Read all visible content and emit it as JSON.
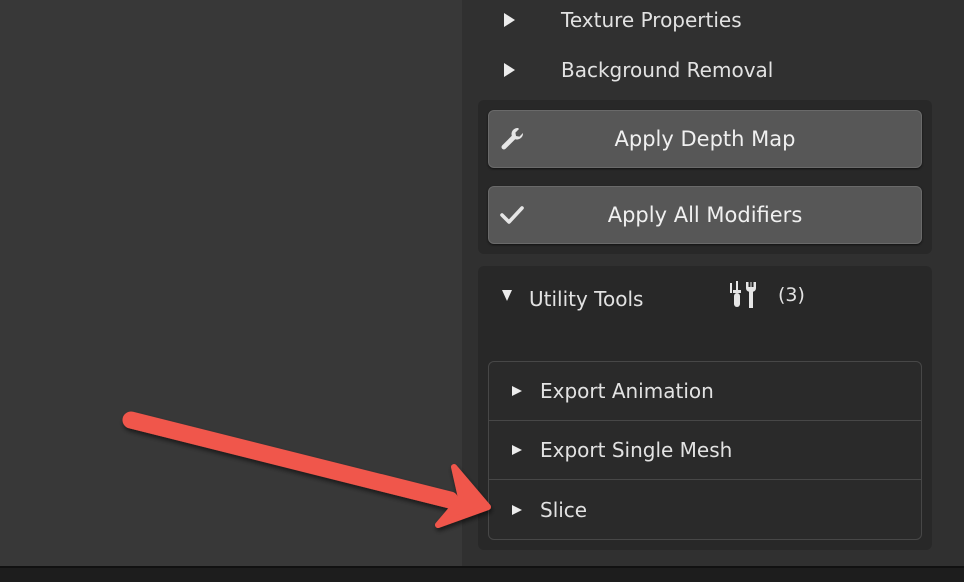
{
  "panel": {
    "subpanels": [
      {
        "label": "Texture Properties"
      },
      {
        "label": "Background Removal"
      }
    ],
    "operations": [
      {
        "label": "Apply Depth Map",
        "icon": "wrench-icon"
      },
      {
        "label": "Apply All Modifiers",
        "icon": "checkmark-icon"
      }
    ],
    "utility": {
      "title": "Utility Tools",
      "icon": "screwdriver-wrench-icon",
      "count": "(3)",
      "items": [
        {
          "label": "Export Animation"
        },
        {
          "label": "Export Single Mesh"
        },
        {
          "label": "Slice"
        }
      ]
    }
  },
  "annotation": {
    "type": "red-arrow",
    "target": "Slice",
    "color": "#f0564b"
  },
  "colors": {
    "background": "#3a3a3a",
    "panel": "#303030",
    "button": "#575757",
    "box": "#282828"
  }
}
